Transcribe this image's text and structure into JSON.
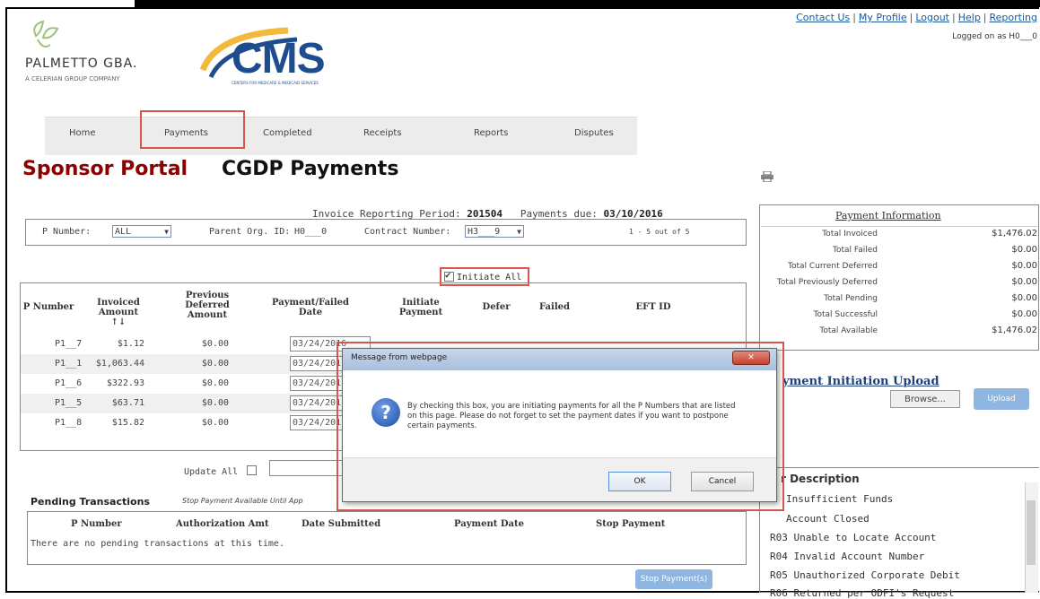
{
  "page_caption": "page",
  "header": {
    "org_name": "PALMETTO GBA.",
    "org_subtitle": "A CELERIAN GROUP COMPANY",
    "cms_logo_text": "CMS",
    "cms_logo_subtitle": "CENTERS FOR MEDICARE & MEDICAID SERVICES",
    "links": [
      "Contact Us",
      "My Profile",
      "Logout",
      "Help",
      "Reporting"
    ],
    "logged_on": "Logged on as H0___0"
  },
  "nav": {
    "tabs": [
      "Home",
      "Payments",
      "Completed",
      "Receipts",
      "Reports",
      "Disputes"
    ],
    "active": "Payments"
  },
  "titles": {
    "portal": "Sponsor Portal",
    "page": "CGDP Payments"
  },
  "period": {
    "label": "Invoice Reporting Period:",
    "value": "201504",
    "due_label": "Payments due:",
    "due_value": "03/10/2016"
  },
  "filters": {
    "p_number_label": "P Number:",
    "p_number_value": "ALL",
    "parent_org_label": "Parent Org. ID:",
    "parent_org_value": "H0___0",
    "contract_label": "Contract Number:",
    "contract_value": "H3___9",
    "count": "1 - 5 out of 5"
  },
  "initiate_all": {
    "label": "Initiate All",
    "checked": true
  },
  "table": {
    "headers": [
      "P Number",
      "Invoiced Amount ↑↓",
      "Previous Deferred Amount",
      "Payment/Failed Date",
      "Initiate Payment",
      "Defer",
      "Failed",
      "EFT ID"
    ],
    "rows": [
      {
        "p": "P1__7",
        "invoiced": "$1.12",
        "deferred": "$0.00",
        "date": "03/24/2016"
      },
      {
        "p": "P1__1",
        "invoiced": "$1,063.44",
        "deferred": "$0.00",
        "date": "03/24/201"
      },
      {
        "p": "P1__6",
        "invoiced": "$322.93",
        "deferred": "$0.00",
        "date": "03/24/201"
      },
      {
        "p": "P1__5",
        "invoiced": "$63.71",
        "deferred": "$0.00",
        "date": "03/24/201"
      },
      {
        "p": "P1__8",
        "invoiced": "$15.82",
        "deferred": "$0.00",
        "date": "03/24/201"
      }
    ]
  },
  "update_all_label": "Update All",
  "pending": {
    "title": "Pending Transactions",
    "note": "Stop Payment Available Until App",
    "headers": [
      "P Number",
      "Authorization Amt",
      "Date Submitted",
      "Payment Date",
      "Stop Payment"
    ],
    "empty_text": "There are no pending transactions at this time.",
    "stop_button": "Stop Payment(s)"
  },
  "payment_info": {
    "title": "Payment Information",
    "rows": [
      {
        "label": "Total Invoiced",
        "value": "$1,476.02"
      },
      {
        "label": "Total Failed",
        "value": "$0.00"
      },
      {
        "label": "Total Current Deferred",
        "value": "$0.00"
      },
      {
        "label": "Total Previously Deferred",
        "value": "$0.00"
      },
      {
        "label": "Total Pending",
        "value": "$0.00"
      },
      {
        "label": "Total Successful",
        "value": "$0.00"
      },
      {
        "label": "Total Available",
        "value": "$1,476.02"
      }
    ]
  },
  "upload": {
    "title": "yment Initiation Upload",
    "browse": "Browse...",
    "upload": "Upload"
  },
  "error_desc": {
    "title": "r Description",
    "items": [
      "Insufficient Funds",
      "Account Closed",
      "R03 Unable to Locate Account",
      "R04 Invalid Account Number",
      "R05 Unauthorized Corporate Debit",
      "R06 Returned per ODFI's Request"
    ]
  },
  "dialog": {
    "title": "Message from webpage",
    "message": "By checking this box, you are initiating payments for all the P Numbers that are listed on this page. Please do not forget to set the payment dates if you want to postpone certain payments.",
    "ok": "OK",
    "cancel": "Cancel",
    "close_glyph": "✕"
  },
  "colors": {
    "highlight": "#d9534f",
    "brand_red": "#8b0000",
    "link": "#1a5aa0",
    "cms_blue": "#1f4c8c"
  }
}
